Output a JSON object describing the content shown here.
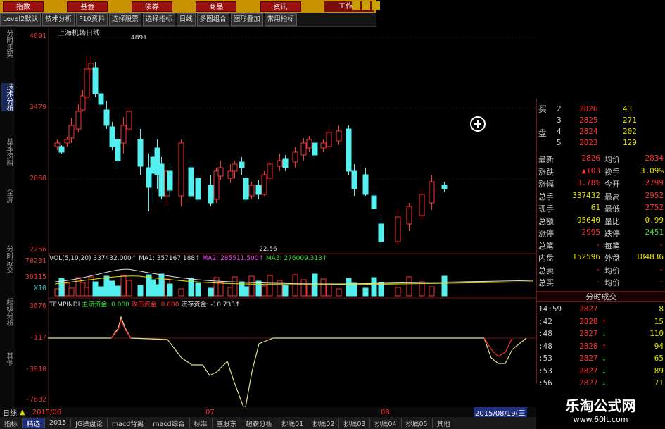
{
  "topbar": {
    "buttons": [
      "指数",
      "基金",
      "债券",
      "商品",
      "资讯"
    ],
    "work": "工作区"
  },
  "toolbar": [
    "Level2默认",
    "技术分析",
    "F10资料",
    "选择股票",
    "选择指标",
    "日线",
    "多图组合",
    "图形叠加",
    "常用指标"
  ],
  "sidebar": [
    "分时走势",
    "技术分析",
    "基本资料",
    "全屏",
    "分时成交",
    "超级分析",
    "其他"
  ],
  "chart": {
    "title": "上海机场日线",
    "high_label": "4891",
    "low_label": "22.56",
    "price_ticks": [
      "4091",
      "3479",
      "2868",
      "2256"
    ],
    "vol_ticks": [
      "78231",
      "39115",
      "X10"
    ],
    "ind_ticks": [
      "3676",
      "-117",
      "-3910",
      "-7632"
    ]
  },
  "vol_header": {
    "label": "VOL(5,10,20)",
    "val": "337432.000↑",
    "ma1": "MA1: 357167.188↑",
    "ma2": "MA2: 285511.500↑",
    "ma3": "MA3: 276009.313↑"
  },
  "ind_header": {
    "label": "TEMPINDI",
    "main": "主流资金: 0.000",
    "attack": "攻击资金: 0.000",
    "flow": "流存资金: -10.733↑"
  },
  "quote": {
    "bids": [
      [
        "2",
        "2826",
        "43"
      ],
      [
        "3",
        "2825",
        "271"
      ],
      [
        "4",
        "2824",
        "202"
      ],
      [
        "5",
        "2823",
        "129"
      ]
    ],
    "buy_label": "买",
    "pan_label": "盘",
    "rows": [
      [
        "最新",
        "2826",
        "均价",
        "2834"
      ],
      [
        "涨跌",
        "▲103",
        "换手",
        "3.09%"
      ],
      [
        "涨幅",
        "3.78%",
        "今开",
        "2799"
      ],
      [
        "总手",
        "337432",
        "最高",
        "2952"
      ],
      [
        "现手",
        "61",
        "最低",
        "2752"
      ],
      [
        "总额",
        "95640",
        "量比",
        "0.99"
      ],
      [
        "涨停",
        "2995",
        "跌停",
        "2451"
      ],
      [
        "总笔",
        "-",
        "每笔",
        "-"
      ],
      [
        "内盘",
        "152596",
        "外盘",
        "184836"
      ],
      [
        "总卖",
        "-",
        "均价",
        "-"
      ],
      [
        "总买",
        "-",
        "均价",
        "-"
      ]
    ],
    "ticks_title": "分时成交",
    "ticks": [
      [
        "14:59",
        "2827",
        "",
        "8"
      ],
      [
        ":42",
        "2828",
        "↑",
        "15"
      ],
      [
        ":48",
        "2827",
        "↓",
        "110"
      ],
      [
        ":48",
        "2828",
        "↑",
        "94"
      ],
      [
        ":53",
        "2827",
        "↓",
        "65"
      ],
      [
        ":53",
        "2827",
        "↓",
        "89"
      ],
      [
        ":56",
        "2827",
        "↓",
        "71"
      ]
    ]
  },
  "footer": {
    "left": "日线",
    "date1": "2015/06",
    "date2": "07",
    "date3": "08",
    "date_box": "2015/08/19(三",
    "tabs": [
      "指标",
      "精选",
      "2015",
      "JG操盘论",
      "macd背离",
      "macd综合",
      "标准",
      "查股东",
      "超霸分析",
      "抄底01",
      "抄底02",
      "抄底03",
      "抄底04",
      "抄底05",
      "其他"
    ]
  },
  "watermark": {
    "text": "乐淘公式网",
    "url": "www.60lt.com"
  },
  "colors": {
    "up": "#ff3030",
    "down": "#54f0f0",
    "ma_white": "#e0e0e0",
    "ma_yellow": "#e0e000",
    "ma_magenta": "#ff40ff"
  }
}
